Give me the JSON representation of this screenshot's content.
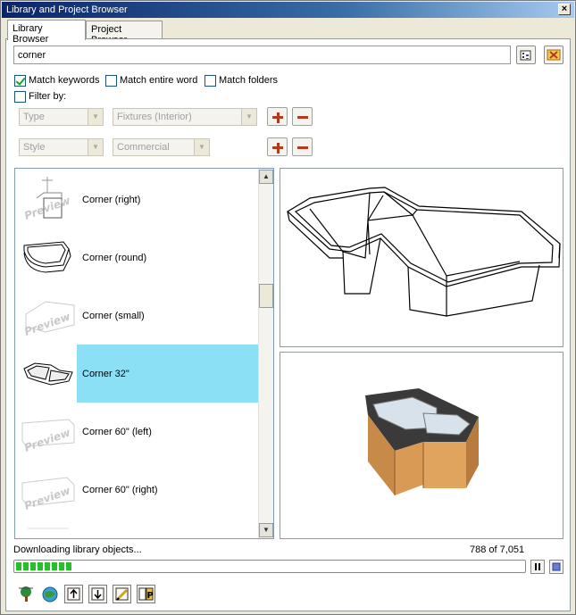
{
  "window": {
    "title": "Library and Project Browser",
    "close_label": "×"
  },
  "tabs": [
    {
      "label": "Library Browser",
      "active": true
    },
    {
      "label": "Project Browser",
      "active": false
    }
  ],
  "search": {
    "value": "corner",
    "placeholder": ""
  },
  "options": {
    "match_keywords": {
      "label": "Match keywords",
      "checked": true
    },
    "match_entire_word": {
      "label": "Match entire word",
      "checked": false
    },
    "match_folders": {
      "label": "Match folders",
      "checked": false
    },
    "filter_by": {
      "label": "Filter by:",
      "checked": false
    }
  },
  "filters": {
    "row1": {
      "left": "Type",
      "right": "Fixtures (Interior)"
    },
    "row2": {
      "left": "Style",
      "right": "Commercial"
    }
  },
  "results": [
    {
      "label": "Corner (right)",
      "thumb": "preview-placeholder"
    },
    {
      "label": "Corner (round)",
      "thumb": "sink-round"
    },
    {
      "label": "Corner (small)",
      "thumb": "preview-placeholder"
    },
    {
      "label": "Corner 32\"",
      "thumb": "sink-corner",
      "selected": true
    },
    {
      "label": "Corner 60\" (left)",
      "thumb": "preview-placeholder"
    },
    {
      "label": "Corner 60\" (right)",
      "thumb": "preview-placeholder"
    }
  ],
  "preview_watermark": "Preview",
  "status": {
    "text": "Downloading library objects...",
    "count": "788 of 7,051",
    "progress": 0.112
  },
  "colors": {
    "selection": "#8ce0f5",
    "progress": "#28c028",
    "accent": "#b23a1e"
  },
  "icons": {
    "folder_button": "folder-search-icon",
    "clear_button": "clear-x-icon",
    "toolbar": [
      "tree-icon",
      "globe-icon",
      "import-icon",
      "export-icon",
      "edit-icon",
      "properties-icon"
    ]
  }
}
